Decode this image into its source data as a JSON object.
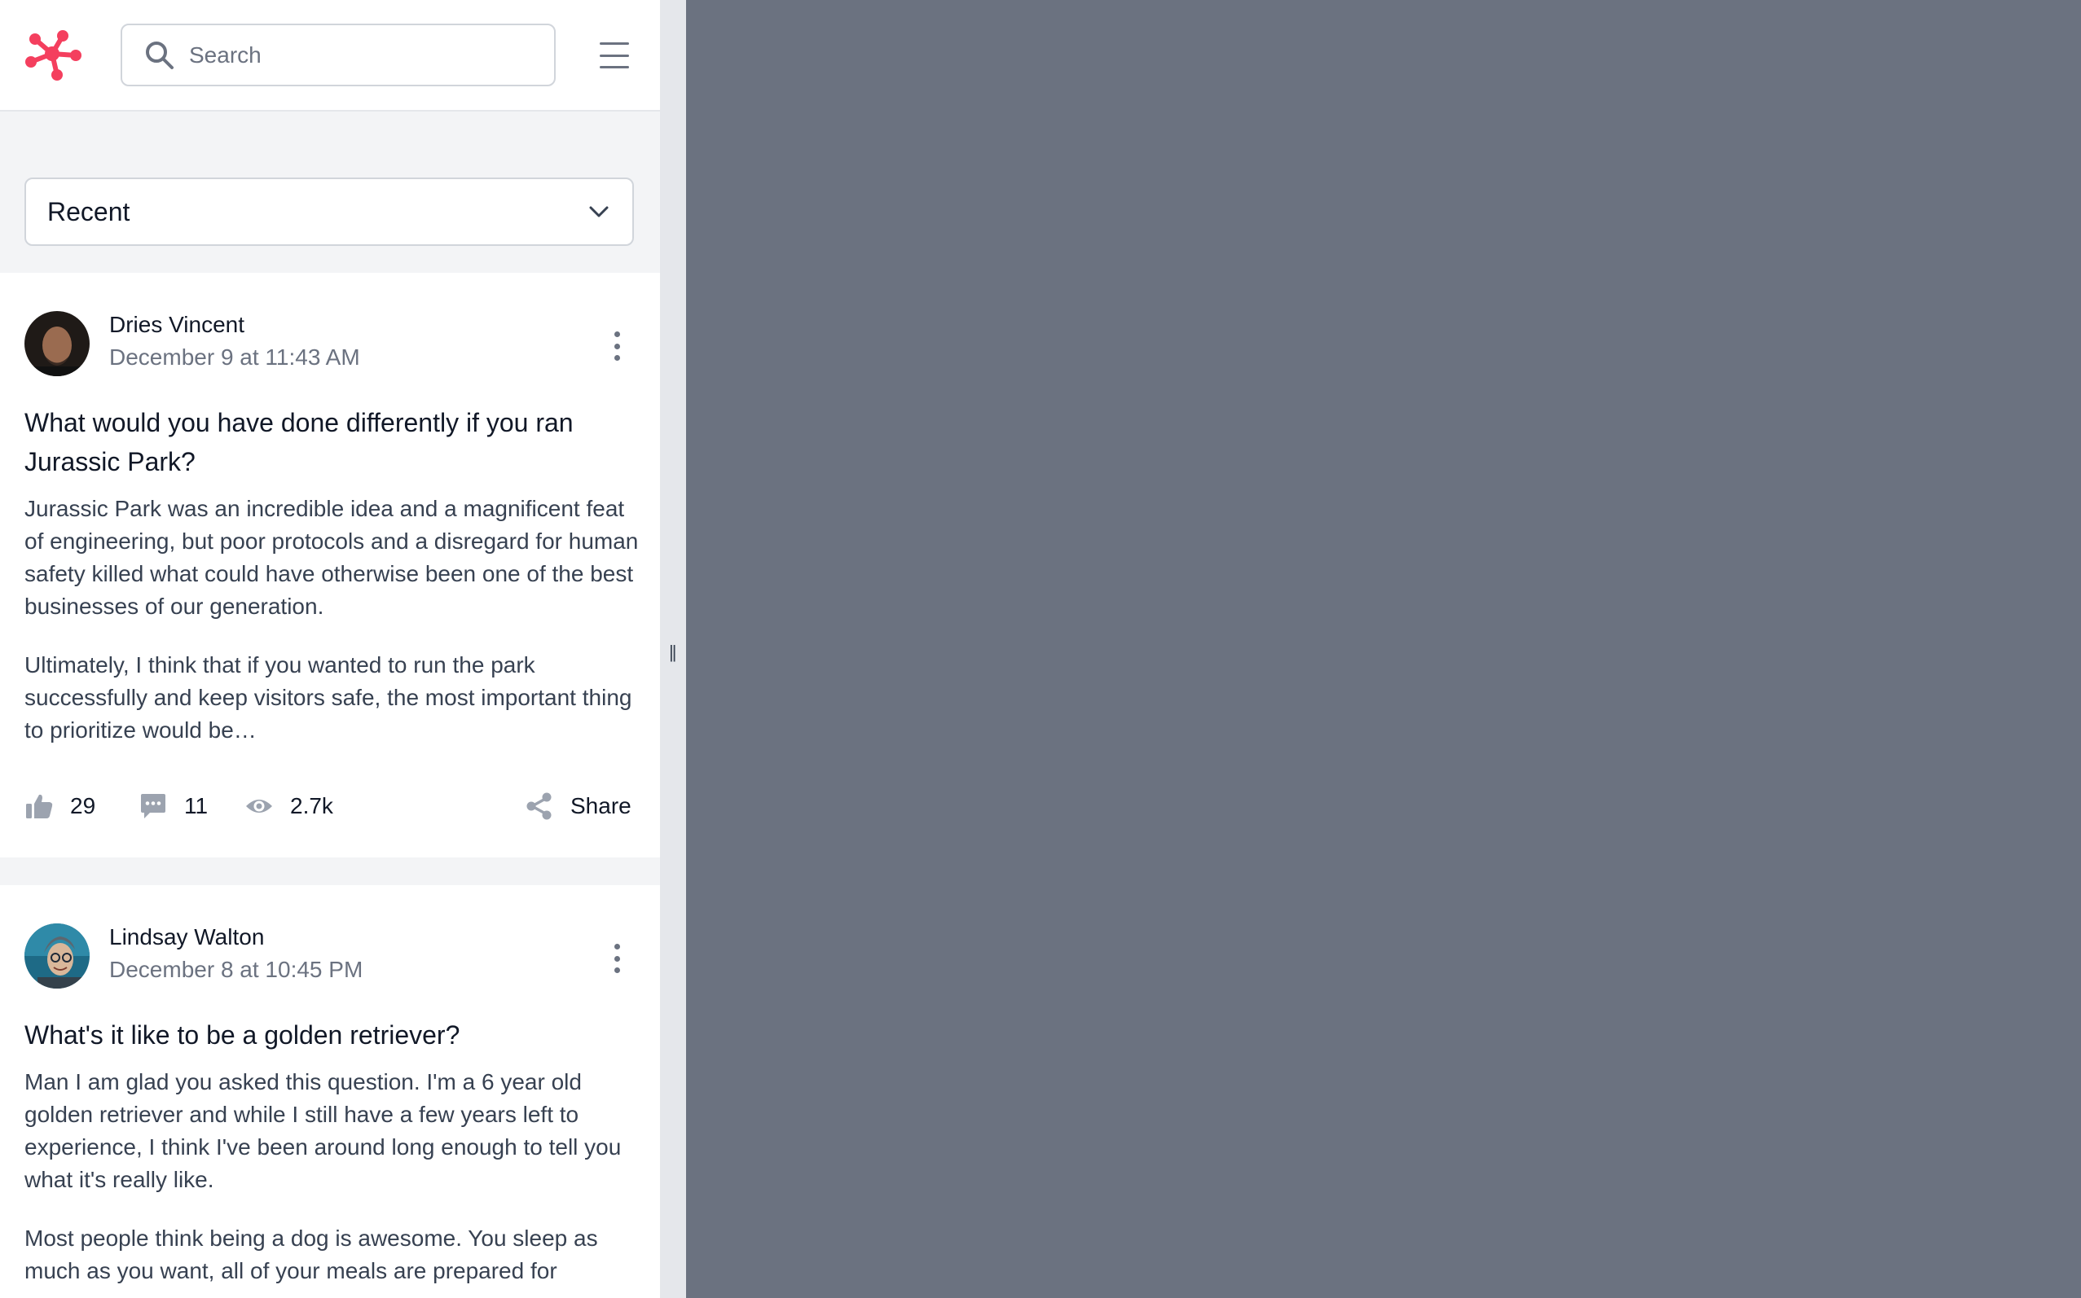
{
  "header": {
    "logo": "brand-logo",
    "search": {
      "placeholder": "Search"
    },
    "menu_icon": "menu-icon"
  },
  "sort": {
    "selected": "Recent",
    "icon": "chevron-down-icon"
  },
  "colors": {
    "brand": "#f43f5e",
    "backdrop": "#6b7280",
    "panel_bg": "#f3f4f6"
  },
  "posts": [
    {
      "author": "Dries Vincent",
      "date": "December 9 at 11:43 AM",
      "title": "What would you have done differently if you ran Jurassic Park?",
      "paragraphs": [
        "Jurassic Park was an incredible idea and a magnificent feat of engineering, but poor protocols and a disregard for human safety killed what could have otherwise been one of the best businesses of our generation.",
        "Ultimately, I think that if you wanted to run the park successfully and keep visitors safe, the most important thing to prioritize would be…"
      ],
      "likes": "29",
      "comments": "11",
      "views": "2.7k",
      "share_label": "Share"
    },
    {
      "author": "Lindsay Walton",
      "date": "December 8 at 10:45 PM",
      "title": "What's it like to be a golden retriever?",
      "paragraphs": [
        "Man I am glad you asked this question. I'm a 6 year old golden retriever and while I still have a few years left to experience, I think I've been around long enough to tell you what it's really like.",
        "Most people think being a dog is awesome. You sleep as much as you want, all of your meals are prepared for"
      ]
    }
  ]
}
